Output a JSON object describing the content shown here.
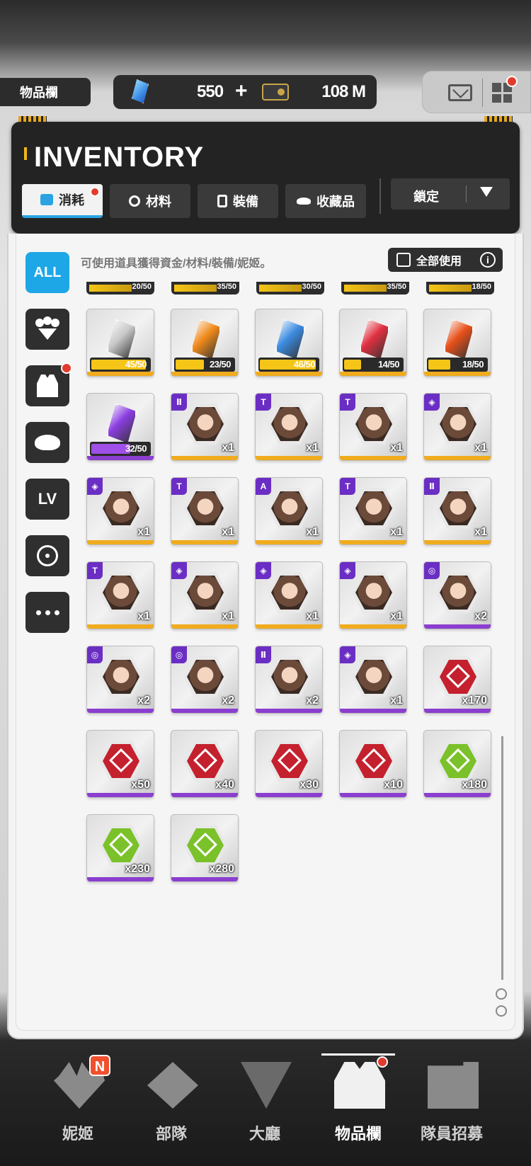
{
  "topbar": {
    "page_label": "物品欄",
    "gems": "550",
    "gems_plus": "+",
    "credits": "108 M"
  },
  "header": {
    "title": "INVENTORY",
    "tabs": [
      {
        "label": "消耗",
        "active": true
      },
      {
        "label": "材料",
        "active": false
      },
      {
        "label": "裝備",
        "active": false
      },
      {
        "label": "收藏品",
        "active": false
      }
    ],
    "lock_dropdown": "鎖定"
  },
  "sidebar": {
    "all_label": "ALL",
    "lv_label": "LV"
  },
  "panel": {
    "description": "可使用道具獲得資金/材料/裝備/妮姬。",
    "use_all_label": "全部使用",
    "info_glyph": "i"
  },
  "partial_row": [
    "20/50",
    "35/50",
    "30/50",
    "35/50",
    "18/50"
  ],
  "colors": {
    "accent_blue": "#1ea7e6",
    "gold": "#f0ac1e",
    "purple": "#8b3ecf",
    "red_dot": "#e23b2e"
  },
  "items": [
    {
      "kind": "box",
      "color": "#c8c8c8",
      "fill": 0.9,
      "fill_color": "#f5c518",
      "text": "45/50"
    },
    {
      "kind": "box",
      "color": "#f08a1a",
      "fill": 0.46,
      "fill_color": "#f5c518",
      "text": "23/50"
    },
    {
      "kind": "box",
      "color": "#3b8be0",
      "fill": 0.92,
      "fill_color": "#f5c518",
      "text": "46/50"
    },
    {
      "kind": "box",
      "color": "#e03040",
      "fill": 0.28,
      "fill_color": "#f5c518",
      "text": "14/50"
    },
    {
      "kind": "box",
      "color": "#e8501a",
      "fill": 0.36,
      "fill_color": "#f5c518",
      "text": "18/50"
    },
    {
      "kind": "box",
      "color": "#8a3de0",
      "fill": 0.64,
      "fill_color": "#a050e8",
      "text": "32/50",
      "rarity": "purple"
    },
    {
      "kind": "face",
      "badge": "Ⅱ",
      "qty": "x1",
      "rarity": "gold"
    },
    {
      "kind": "face",
      "badge": "T",
      "qty": "x1",
      "rarity": "gold"
    },
    {
      "kind": "face",
      "badge": "T",
      "qty": "x1",
      "rarity": "gold"
    },
    {
      "kind": "face",
      "badge": "◈",
      "qty": "x1",
      "rarity": "gold"
    },
    {
      "kind": "face",
      "badge": "◈",
      "qty": "x1",
      "rarity": "gold"
    },
    {
      "kind": "face",
      "badge": "T",
      "qty": "x1",
      "rarity": "gold"
    },
    {
      "kind": "face",
      "badge": "A",
      "qty": "x1",
      "rarity": "gold"
    },
    {
      "kind": "face",
      "badge": "T",
      "qty": "x1",
      "rarity": "gold"
    },
    {
      "kind": "face",
      "badge": "Ⅱ",
      "qty": "x1",
      "rarity": "gold"
    },
    {
      "kind": "face",
      "badge": "T",
      "qty": "x1",
      "rarity": "gold"
    },
    {
      "kind": "face",
      "badge": "◈",
      "qty": "x1",
      "rarity": "gold"
    },
    {
      "kind": "face",
      "badge": "◈",
      "qty": "x1",
      "rarity": "gold"
    },
    {
      "kind": "face",
      "badge": "◈",
      "qty": "x1",
      "rarity": "gold"
    },
    {
      "kind": "face",
      "badge": "◎",
      "qty": "x2",
      "rarity": "purple"
    },
    {
      "kind": "face",
      "badge": "◎",
      "qty": "x2",
      "rarity": "purple"
    },
    {
      "kind": "face",
      "badge": "◎",
      "qty": "x2",
      "rarity": "purple"
    },
    {
      "kind": "face",
      "badge": "Ⅱ",
      "qty": "x2",
      "rarity": "purple"
    },
    {
      "kind": "face",
      "badge": "◈",
      "qty": "x1",
      "rarity": "purple"
    },
    {
      "kind": "symbol",
      "symbol_color": "red",
      "qty": "x170",
      "rarity": "purple"
    },
    {
      "kind": "symbol",
      "symbol_color": "red",
      "qty": "x50",
      "rarity": "purple"
    },
    {
      "kind": "symbol",
      "symbol_color": "red",
      "qty": "x40",
      "rarity": "purple"
    },
    {
      "kind": "symbol",
      "symbol_color": "red",
      "qty": "x30",
      "rarity": "purple"
    },
    {
      "kind": "symbol",
      "symbol_color": "red",
      "qty": "x10",
      "rarity": "purple"
    },
    {
      "kind": "symbol",
      "symbol_color": "green",
      "qty": "x180",
      "rarity": "purple"
    },
    {
      "kind": "symbol",
      "symbol_color": "green",
      "qty": "x230",
      "rarity": "purple"
    },
    {
      "kind": "symbol",
      "symbol_color": "green",
      "qty": "x280",
      "rarity": "purple"
    }
  ],
  "bottom_nav": [
    {
      "label": "妮姬",
      "icon": "nikke-icon",
      "active": false,
      "badge": "N"
    },
    {
      "label": "部隊",
      "icon": "squad-icon",
      "active": false
    },
    {
      "label": "大廳",
      "icon": "lobby-icon",
      "active": false
    },
    {
      "label": "物品欄",
      "icon": "inventory-icon",
      "active": true
    },
    {
      "label": "隊員招募",
      "icon": "recruit-icon",
      "active": false
    }
  ]
}
